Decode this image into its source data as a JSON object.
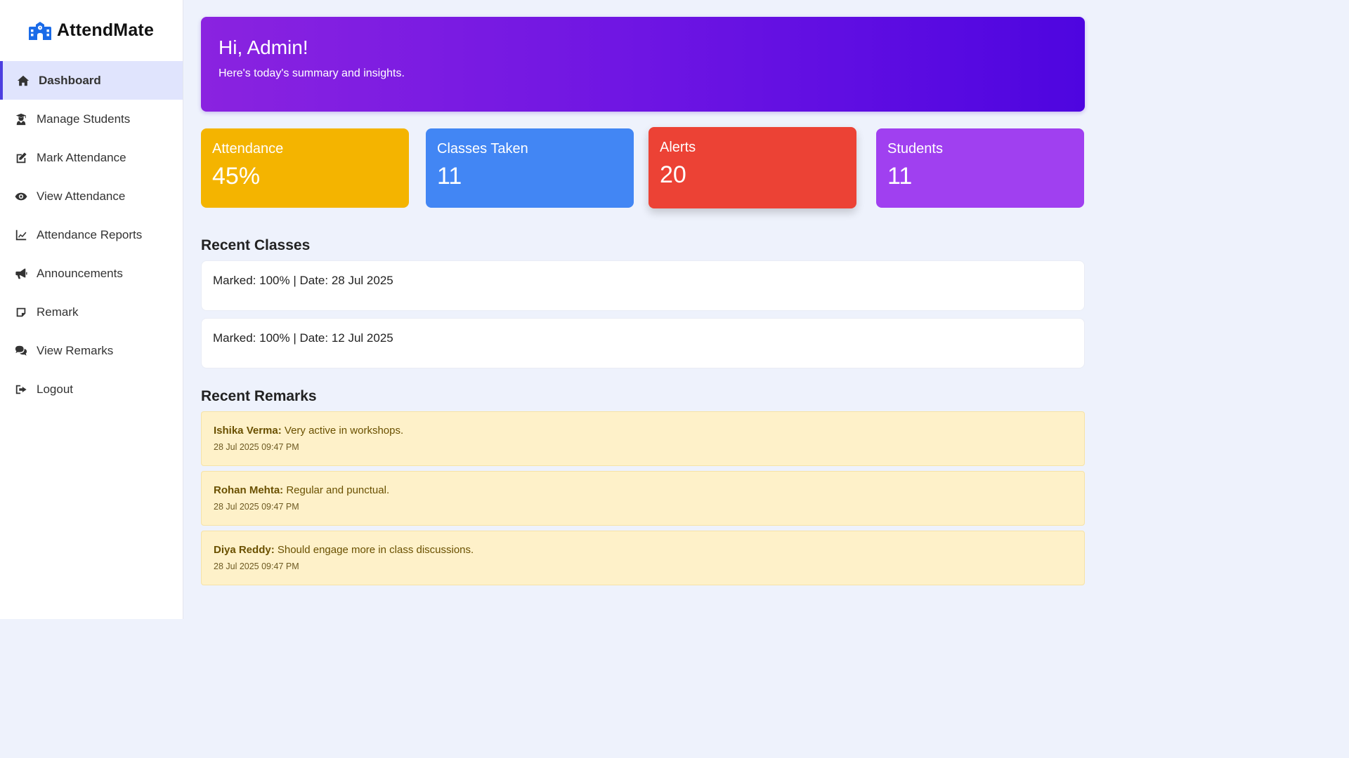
{
  "brand": {
    "name": "AttendMate",
    "color": "#1a6be8"
  },
  "sidebar": {
    "items": [
      {
        "label": "Dashboard",
        "icon": "home-icon",
        "active": true
      },
      {
        "label": "Manage Students",
        "icon": "user-graduate-icon"
      },
      {
        "label": "Mark Attendance",
        "icon": "edit-icon"
      },
      {
        "label": "View Attendance",
        "icon": "eye-icon"
      },
      {
        "label": "Attendance Reports",
        "icon": "chart-line-icon"
      },
      {
        "label": "Announcements",
        "icon": "megaphone-icon"
      },
      {
        "label": "Remark",
        "icon": "sticky-note-icon"
      },
      {
        "label": "View Remarks",
        "icon": "comments-icon"
      },
      {
        "label": "Logout",
        "icon": "sign-out-icon"
      }
    ]
  },
  "hero": {
    "greeting": "Hi, Admin!",
    "subtitle": "Here's today's summary and insights."
  },
  "stats": [
    {
      "label": "Attendance",
      "value": "45%",
      "color": "#f4b400"
    },
    {
      "label": "Classes Taken",
      "value": "11",
      "color": "#4286f4"
    },
    {
      "label": "Alerts",
      "value": "20",
      "color": "#ec4235"
    },
    {
      "label": "Students",
      "value": "11",
      "color": "#a040f0"
    }
  ],
  "recent_classes": {
    "title": "Recent Classes",
    "items": [
      "Marked: 100% | Date: 28 Jul 2025",
      "Marked: 100% | Date: 12 Jul 2025"
    ]
  },
  "recent_remarks": {
    "title": "Recent Remarks",
    "items": [
      {
        "name": "Ishika Verma:",
        "text": " Very active in workshops.",
        "time": "28 Jul 2025 09:47 PM"
      },
      {
        "name": "Rohan Mehta:",
        "text": " Regular and punctual.",
        "time": "28 Jul 2025 09:47 PM"
      },
      {
        "name": "Diya Reddy:",
        "text": " Should engage more in class discussions.",
        "time": "28 Jul 2025 09:47 PM"
      }
    ]
  }
}
